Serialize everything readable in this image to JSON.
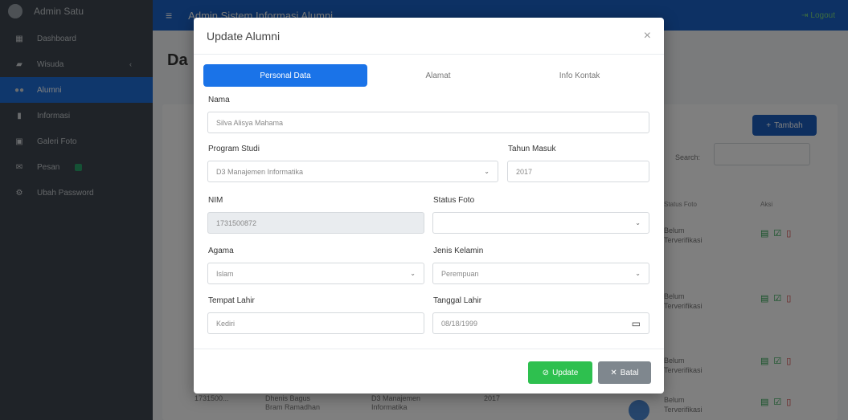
{
  "sidebar": {
    "user_name": "Admin Satu",
    "items": [
      {
        "label": "Dashboard",
        "icon": "grid-icon"
      },
      {
        "label": "Wisuda",
        "icon": "graduation-icon"
      },
      {
        "label": "Alumni",
        "icon": "users-icon"
      },
      {
        "label": "Informasi",
        "icon": "file-icon"
      },
      {
        "label": "Galeri Foto",
        "icon": "image-icon"
      },
      {
        "label": "Pesan",
        "icon": "mail-icon"
      },
      {
        "label": "Ubah Password",
        "icon": "gear-icon"
      }
    ]
  },
  "topbar": {
    "title": "Admin Sistem Informasi Alumni",
    "logout_label": "Logout",
    "color": "#1b63c9"
  },
  "page": {
    "title": "Da",
    "add_label": "Tambah",
    "search_label": "Search:",
    "table_headers": {
      "status_foto": "Status Foto",
      "aksi": "Aksi"
    },
    "status_text": "Belum Terverifikasi",
    "last_row": {
      "nim": "1731500...",
      "nama": "Dhenis Bagus Bram Ramadhan",
      "prodi": "D3 Manajemen Informatika",
      "tahun": "2017"
    }
  },
  "modal": {
    "title": "Update Alumni",
    "close_symbol": "×",
    "tabs": [
      {
        "label": "Personal Data",
        "active": true
      },
      {
        "label": "Alamat",
        "active": false
      },
      {
        "label": "Info Kontak",
        "active": false
      }
    ],
    "form": {
      "nama": {
        "label": "Nama",
        "value": "Silva Alisya Mahama"
      },
      "program_studi": {
        "label": "Program Studi",
        "value": "D3 Manajemen Informatika"
      },
      "tahun_masuk": {
        "label": "Tahun Masuk",
        "value": "2017"
      },
      "nim": {
        "label": "NIM",
        "value": "1731500872"
      },
      "status_foto": {
        "label": "Status Foto",
        "value": ""
      },
      "agama": {
        "label": "Agama",
        "value": "Islam"
      },
      "jenis_kelamin": {
        "label": "Jenis Kelamin",
        "value": "Perempuan"
      },
      "tempat_lahir": {
        "label": "Tempat Lahir",
        "value": "Kediri"
      },
      "tanggal_lahir": {
        "label": "Tanggal Lahir",
        "value": "08/18/1999"
      }
    },
    "buttons": {
      "update": "Update",
      "cancel": "Batal"
    },
    "colors": {
      "update": "#2ec04f",
      "cancel": "#7f878e",
      "tab_active": "#1a73e8"
    }
  }
}
